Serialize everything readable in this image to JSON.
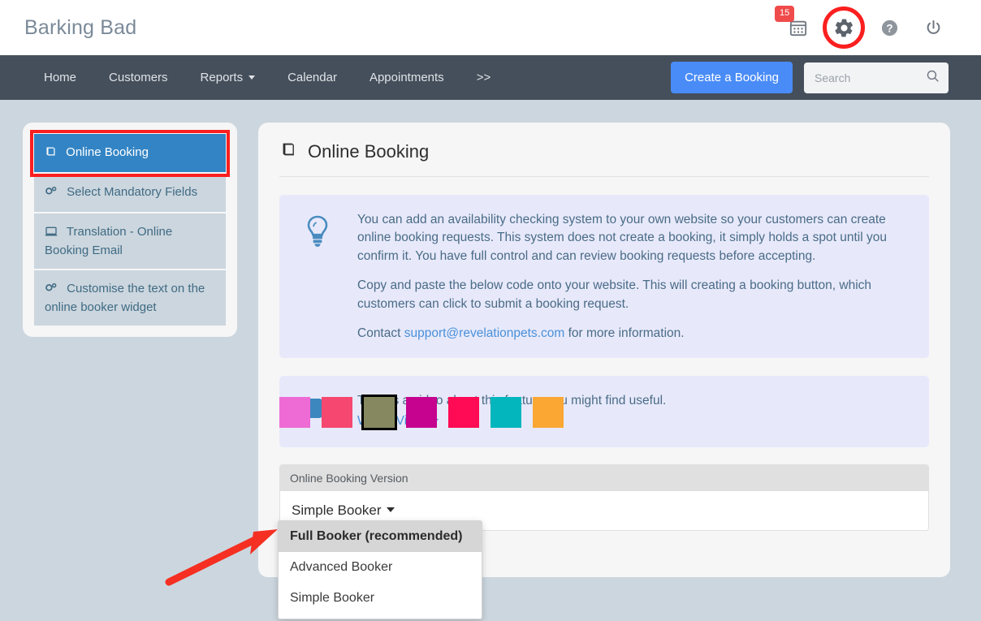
{
  "app": {
    "brand": "Barking Bad"
  },
  "topbar": {
    "calendar_badge": "15",
    "icons": {
      "calendar": "calendar-icon",
      "settings": "gear-icon",
      "help": "question-circle-icon",
      "power": "power-icon"
    }
  },
  "nav": {
    "items": [
      {
        "label": "Home",
        "caret": false
      },
      {
        "label": "Customers",
        "caret": false
      },
      {
        "label": "Reports",
        "caret": true
      },
      {
        "label": "Calendar",
        "caret": false
      },
      {
        "label": "Appointments",
        "caret": false
      },
      {
        "label": ">>",
        "caret": false
      }
    ],
    "create_booking_label": "Create a Booking",
    "search_placeholder": "Search",
    "search_value": ""
  },
  "sidebar": {
    "items": [
      {
        "label": "Online Booking",
        "icon": "book-icon",
        "active": true
      },
      {
        "label": "Select Mandatory Fields",
        "icon": "cogs-icon",
        "active": false
      },
      {
        "label": "Translation - Online Booking Email",
        "icon": "laptop-icon",
        "active": false
      },
      {
        "label": "Customise the text on the online booker widget",
        "icon": "cogs-icon",
        "active": false
      }
    ]
  },
  "main": {
    "title": "Online Booking",
    "title_icon": "book-icon",
    "info": {
      "icon": "lightbulb-icon",
      "paragraph1": "You can add an availability checking system to your own website so your customers can create online booking requests. This system does not create a booking, it simply holds a spot until you confirm it. You have full control and can review booking requests before accepting.",
      "paragraph2": "Copy and paste the below code onto your website. This will creating a booking button, which customers can click to submit a booking request.",
      "contact_prefix": "Contact ",
      "contact_email": "support@revelationpets.com",
      "contact_suffix": " for more information."
    },
    "video": {
      "icon": "video-camera-icon",
      "text": "There's a video about this feature you might find useful.",
      "link_label": "Watch Video"
    },
    "version": {
      "label": "Online Booking Version",
      "selected": "Simple Booker",
      "options": [
        {
          "label": "Full Booker (recommended)",
          "highlighted": true
        },
        {
          "label": "Advanced Booker",
          "highlighted": false
        },
        {
          "label": "Simple Booker",
          "highlighted": false
        }
      ]
    },
    "swatches": [
      {
        "color": "#ee6bd6",
        "selected": false
      },
      {
        "color": "#f5476f",
        "selected": false
      },
      {
        "color": "#86895f",
        "selected": true
      },
      {
        "color": "#c5038f",
        "selected": false
      },
      {
        "color": "#ff0a54",
        "selected": false
      },
      {
        "color": "#03b6bd",
        "selected": false
      },
      {
        "color": "#fba734",
        "selected": false
      }
    ]
  },
  "annotations": {
    "highlight_color": "#fb1f1f",
    "arrow_color": "#f52f22"
  }
}
